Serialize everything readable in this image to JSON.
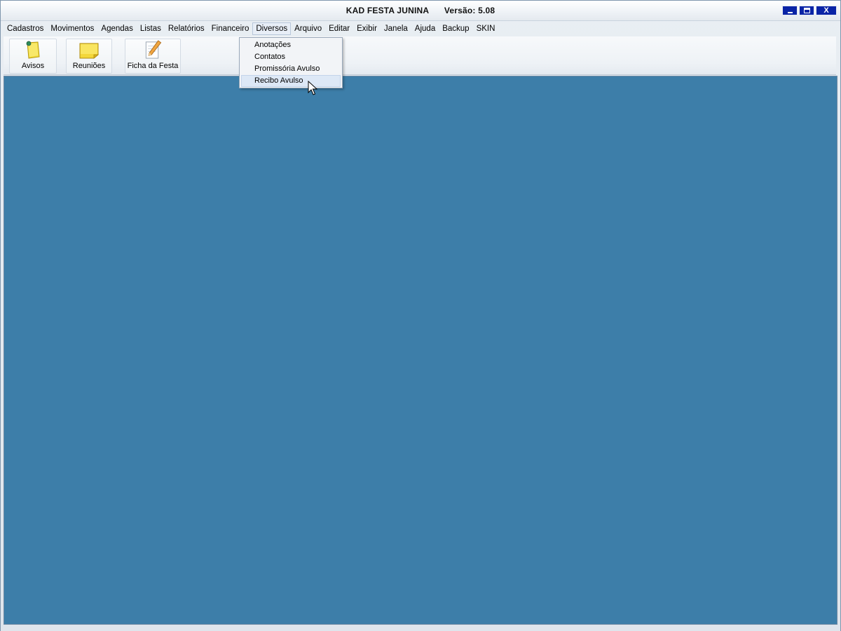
{
  "window": {
    "title": "KAD FESTA JUNINA",
    "version": "Versão: 5.08",
    "controls": {
      "minimize": "minimize-icon",
      "maximize": "maximize-icon",
      "close": "X"
    }
  },
  "menubar": {
    "items": [
      {
        "label": "Cadastros"
      },
      {
        "label": "Movimentos"
      },
      {
        "label": "Agendas"
      },
      {
        "label": "Listas"
      },
      {
        "label": "Relatórios"
      },
      {
        "label": "Financeiro"
      },
      {
        "label": "Diversos",
        "open": true
      },
      {
        "label": "Arquivo"
      },
      {
        "label": "Editar"
      },
      {
        "label": "Exibir"
      },
      {
        "label": "Janela"
      },
      {
        "label": "Ajuda"
      },
      {
        "label": "Backup"
      },
      {
        "label": "SKIN"
      }
    ]
  },
  "toolbar": {
    "buttons": [
      {
        "label": "Avisos",
        "icon": "note-pin-icon"
      },
      {
        "label": "Reuniões",
        "icon": "sticky-note-icon"
      },
      {
        "label": "Ficha da Festa",
        "icon": "pencil-paper-icon"
      }
    ]
  },
  "dropdown": {
    "menu": "Diversos",
    "items": [
      {
        "label": "Anotações"
      },
      {
        "label": "Contatos"
      },
      {
        "label": "Promissória Avulso"
      },
      {
        "label": "Recibo Avulso",
        "highlighted": true
      }
    ]
  },
  "colors": {
    "client_background": "#3d7ea9",
    "titlebar_buttons": "#0a24a6",
    "menu_highlight": "#dde8f6"
  }
}
